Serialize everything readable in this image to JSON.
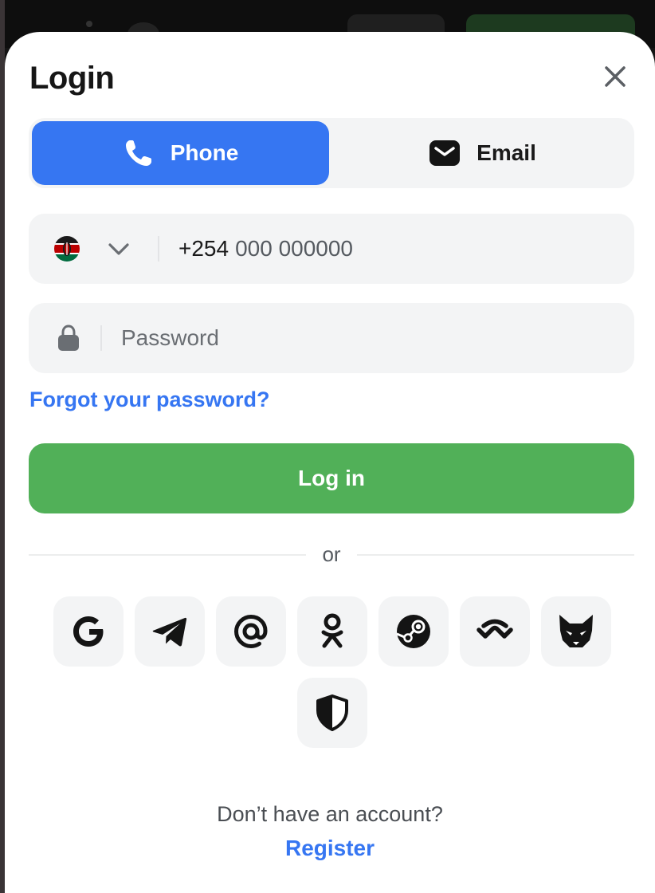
{
  "modal": {
    "title": "Login"
  },
  "tabs": [
    {
      "label": "Phone",
      "icon": "phone-icon",
      "active": true
    },
    {
      "label": "Email",
      "icon": "email-icon",
      "active": false
    }
  ],
  "phone_field": {
    "country_flag": "kenya-flag-icon",
    "country_code": "+254",
    "placeholder": "000 000000"
  },
  "password_field": {
    "placeholder": "Password"
  },
  "forgot_password": "Forgot your password?",
  "login_button": "Log in",
  "divider_text": "or",
  "social_logins": [
    "google-icon",
    "telegram-icon",
    "mail-ru-at-icon",
    "odnoklassniki-icon",
    "steam-icon",
    "walletconnect-icon",
    "metamask-fox-icon",
    "shield-icon"
  ],
  "footer": {
    "prompt": "Don’t have an account?",
    "register": "Register"
  },
  "colors": {
    "accent_blue": "#3676f2",
    "login_green": "#51b058",
    "field_bg": "#f3f4f5"
  }
}
